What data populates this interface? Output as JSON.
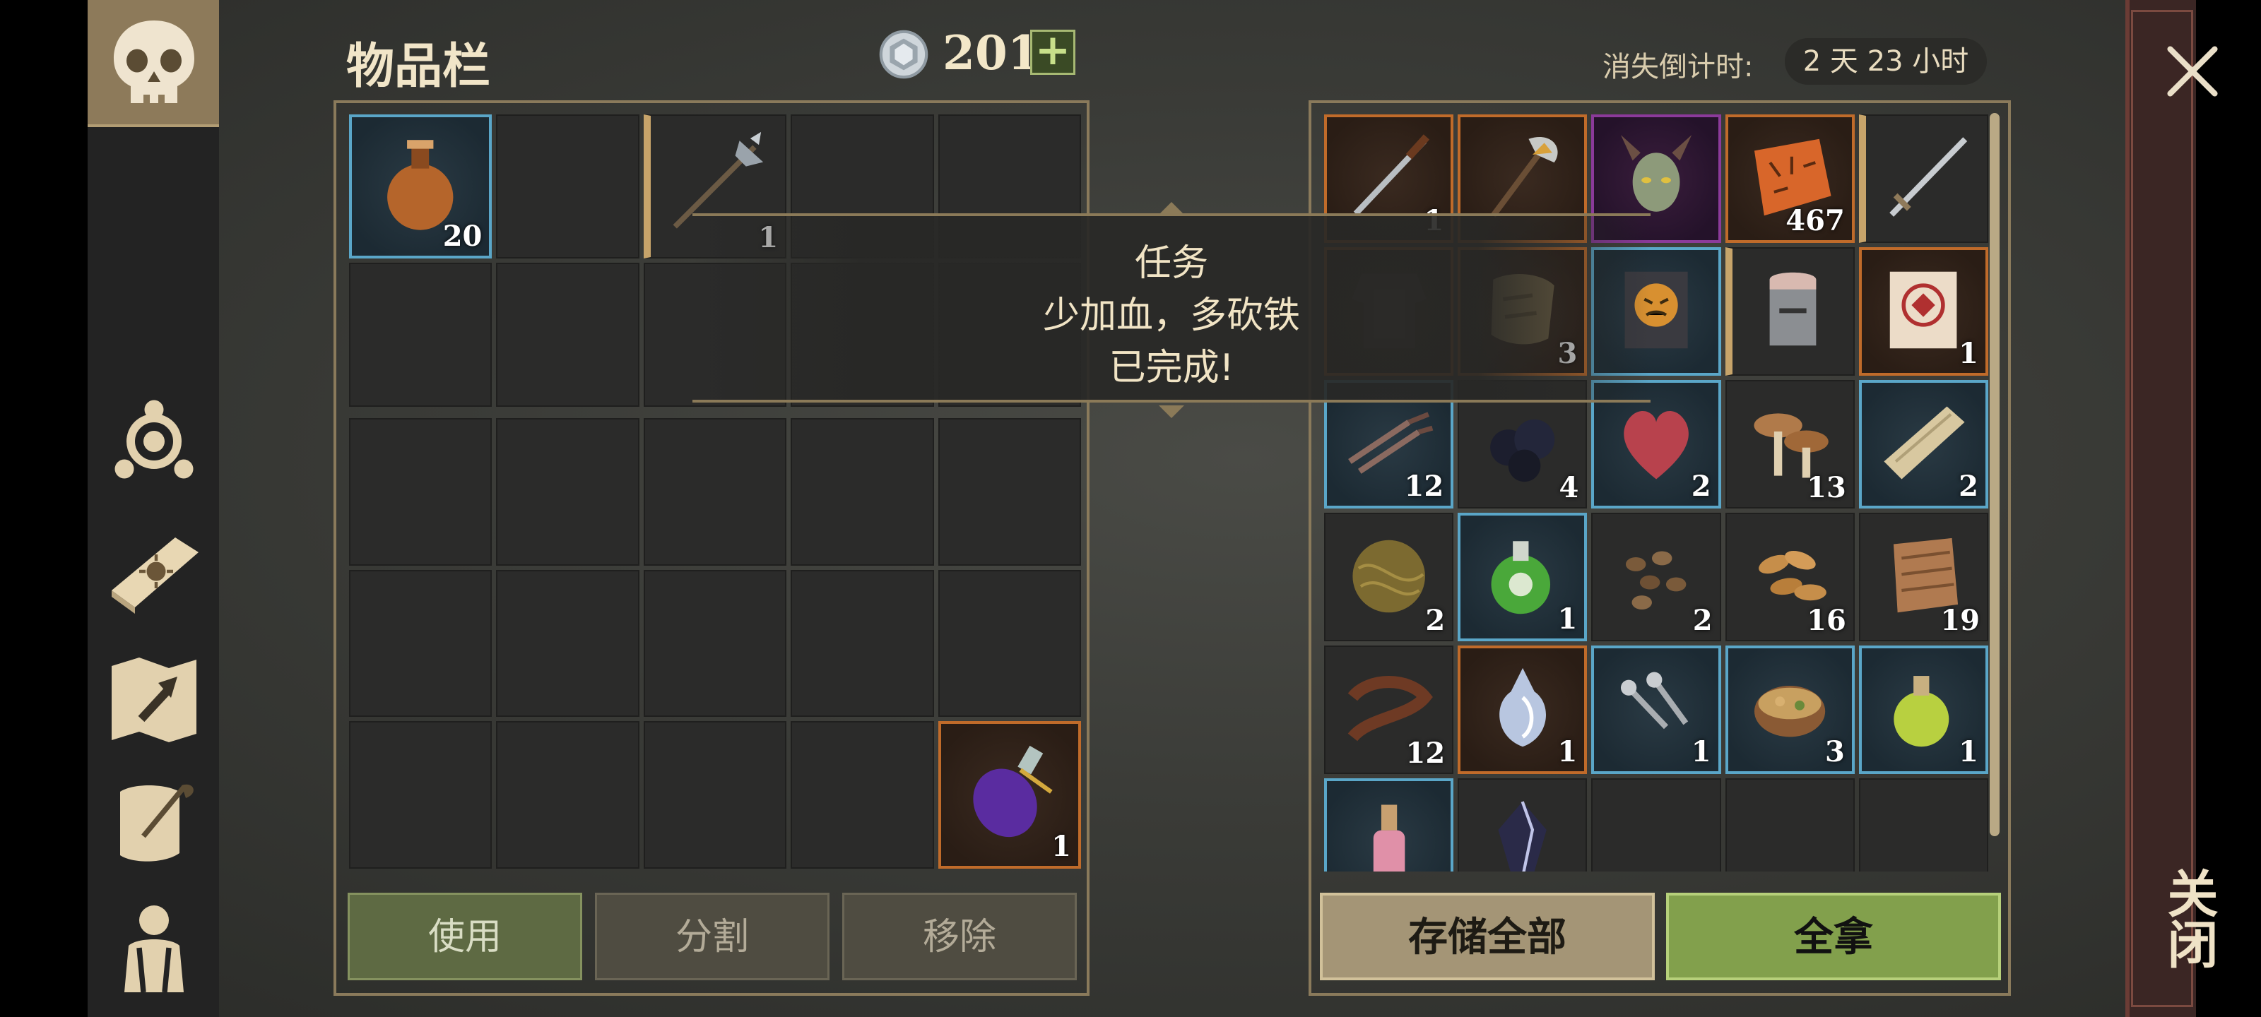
{
  "header": {
    "title": "物品栏",
    "coin_count": "201",
    "plus": "+",
    "timer_label": "消失倒计时:",
    "timer_value": "2 天 23 小时"
  },
  "close": {
    "label": "关闭",
    "icon": "close-icon"
  },
  "sidebar": {
    "items": [
      {
        "name": "skull-icon",
        "active": true
      },
      {
        "name": "clan-icon",
        "active": false
      },
      {
        "name": "sun-book-icon",
        "active": false
      },
      {
        "name": "crafting-map-icon",
        "active": false
      },
      {
        "name": "quill-scroll-icon",
        "active": false
      },
      {
        "name": "character-icon",
        "active": false
      }
    ]
  },
  "left_inventory": {
    "items": [
      {
        "name": "leather-flask-icon",
        "count": "20",
        "rarity": "rare"
      },
      {
        "name": "halberd-icon",
        "count": "1",
        "rarity": "uncommon"
      },
      {
        "name": "purple-potion-icon",
        "count": "1",
        "rarity": "epic"
      }
    ]
  },
  "right_inventory": {
    "items": [
      {
        "name": "dagger-icon",
        "count": "1",
        "rarity": "epic"
      },
      {
        "name": "axe-icon",
        "count": "",
        "rarity": "epic"
      },
      {
        "name": "demon-head-icon",
        "count": "",
        "rarity": "legend"
      },
      {
        "name": "rune-stone-icon",
        "count": "467",
        "rarity": "epic"
      },
      {
        "name": "sword-icon",
        "count": "",
        "rarity": "uncommon"
      },
      {
        "name": "chest-armor-icon",
        "count": "",
        "rarity": "epic"
      },
      {
        "name": "rag-icon",
        "count": "3",
        "rarity": "epic"
      },
      {
        "name": "book-icon",
        "count": "",
        "rarity": "rare"
      },
      {
        "name": "helmet-icon",
        "count": "",
        "rarity": "uncommon"
      },
      {
        "name": "scroll-icon",
        "count": "1",
        "rarity": "epic"
      },
      {
        "name": "claw-icon",
        "count": "12",
        "rarity": "rare"
      },
      {
        "name": "coal-icon",
        "count": "4",
        "rarity": "none"
      },
      {
        "name": "heart-icon",
        "count": "2",
        "rarity": "rare"
      },
      {
        "name": "mushroom-icon",
        "count": "13",
        "rarity": "none"
      },
      {
        "name": "plank-icon",
        "count": "2",
        "rarity": "rare"
      },
      {
        "name": "fiber-ball-icon",
        "count": "2",
        "rarity": "none"
      },
      {
        "name": "green-potion-icon",
        "count": "1",
        "rarity": "rare"
      },
      {
        "name": "seeds-icon",
        "count": "2",
        "rarity": "none"
      },
      {
        "name": "almonds-icon",
        "count": "16",
        "rarity": "none"
      },
      {
        "name": "cloth-icon",
        "count": "19",
        "rarity": "none"
      },
      {
        "name": "leather-strap-icon",
        "count": "12",
        "rarity": "none"
      },
      {
        "name": "silver-vial-icon",
        "count": "1",
        "rarity": "epic"
      },
      {
        "name": "nails-icon",
        "count": "1",
        "rarity": "rare"
      },
      {
        "name": "stew-icon",
        "count": "3",
        "rarity": "rare"
      },
      {
        "name": "yellow-potion-icon",
        "count": "1",
        "rarity": "rare"
      },
      {
        "name": "pink-potion-icon",
        "count": "",
        "rarity": "rare"
      },
      {
        "name": "crystal-icon",
        "count": "",
        "rarity": "none"
      }
    ]
  },
  "toast": {
    "title": "任务",
    "message": "少加血，多砍铁",
    "status": "已完成!"
  },
  "buttons": {
    "use": "使用",
    "split": "分割",
    "remove": "移除",
    "store_all": "存储全部",
    "take_all": "全拿"
  },
  "colors": {
    "rare": "#5aa6c8",
    "epic": "#c06b2a",
    "legend": "#8b3a9a",
    "uncommon": "#c7a46a",
    "take_button": "#82a04c",
    "store_button": "#a49576",
    "use_button": "#5e6a43"
  }
}
